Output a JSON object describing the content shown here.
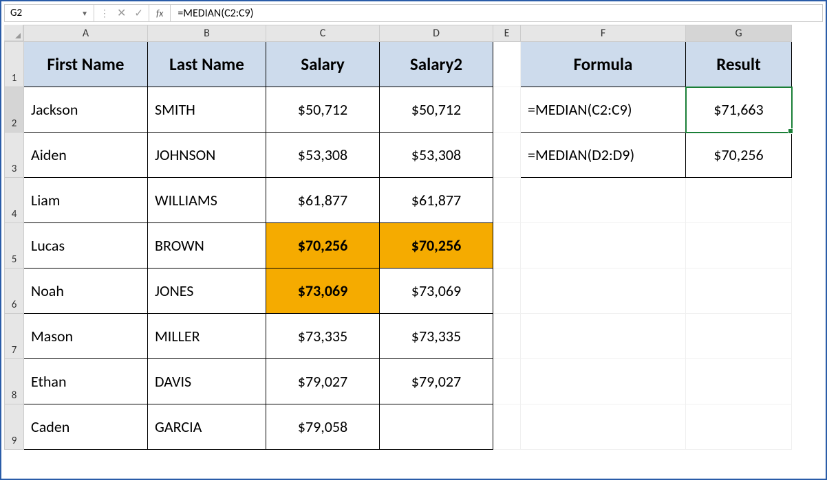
{
  "nameBox": "G2",
  "fxLabel": "fx",
  "formulaBar": "=MEDIAN(C2:C9)",
  "columns": [
    "A",
    "B",
    "C",
    "D",
    "E",
    "F",
    "G"
  ],
  "rows": [
    "1",
    "2",
    "3",
    "4",
    "5",
    "6",
    "7",
    "8",
    "9"
  ],
  "headersMain": {
    "A": "First Name",
    "B": "Last Name",
    "C": "Salary",
    "D": "Salary2"
  },
  "headersSide": {
    "F": "Formula",
    "G": "Result"
  },
  "data": [
    {
      "first": "Jackson",
      "last": "SMITH",
      "salary": "$50,712",
      "salary2": "$50,712"
    },
    {
      "first": "Aiden",
      "last": "JOHNSON",
      "salary": "$53,308",
      "salary2": "$53,308"
    },
    {
      "first": "Liam",
      "last": "WILLIAMS",
      "salary": "$61,877",
      "salary2": "$61,877"
    },
    {
      "first": "Lucas",
      "last": "BROWN",
      "salary": "$70,256",
      "salary2": "$70,256",
      "hlC": true,
      "hlD": true
    },
    {
      "first": "Noah",
      "last": "JONES",
      "salary": "$73,069",
      "salary2": "$73,069",
      "hlC": true
    },
    {
      "first": "Mason",
      "last": "MILLER",
      "salary": "$73,335",
      "salary2": "$73,335"
    },
    {
      "first": "Ethan",
      "last": "DAVIS",
      "salary": "$79,027",
      "salary2": "$79,027"
    },
    {
      "first": "Caden",
      "last": "GARCIA",
      "salary": "$79,058",
      "salary2": ""
    }
  ],
  "side": [
    {
      "formula": "=MEDIAN(C2:C9)",
      "result": "$71,663"
    },
    {
      "formula": "=MEDIAN(D2:D9)",
      "result": "$70,256"
    }
  ],
  "activeCell": "G2"
}
